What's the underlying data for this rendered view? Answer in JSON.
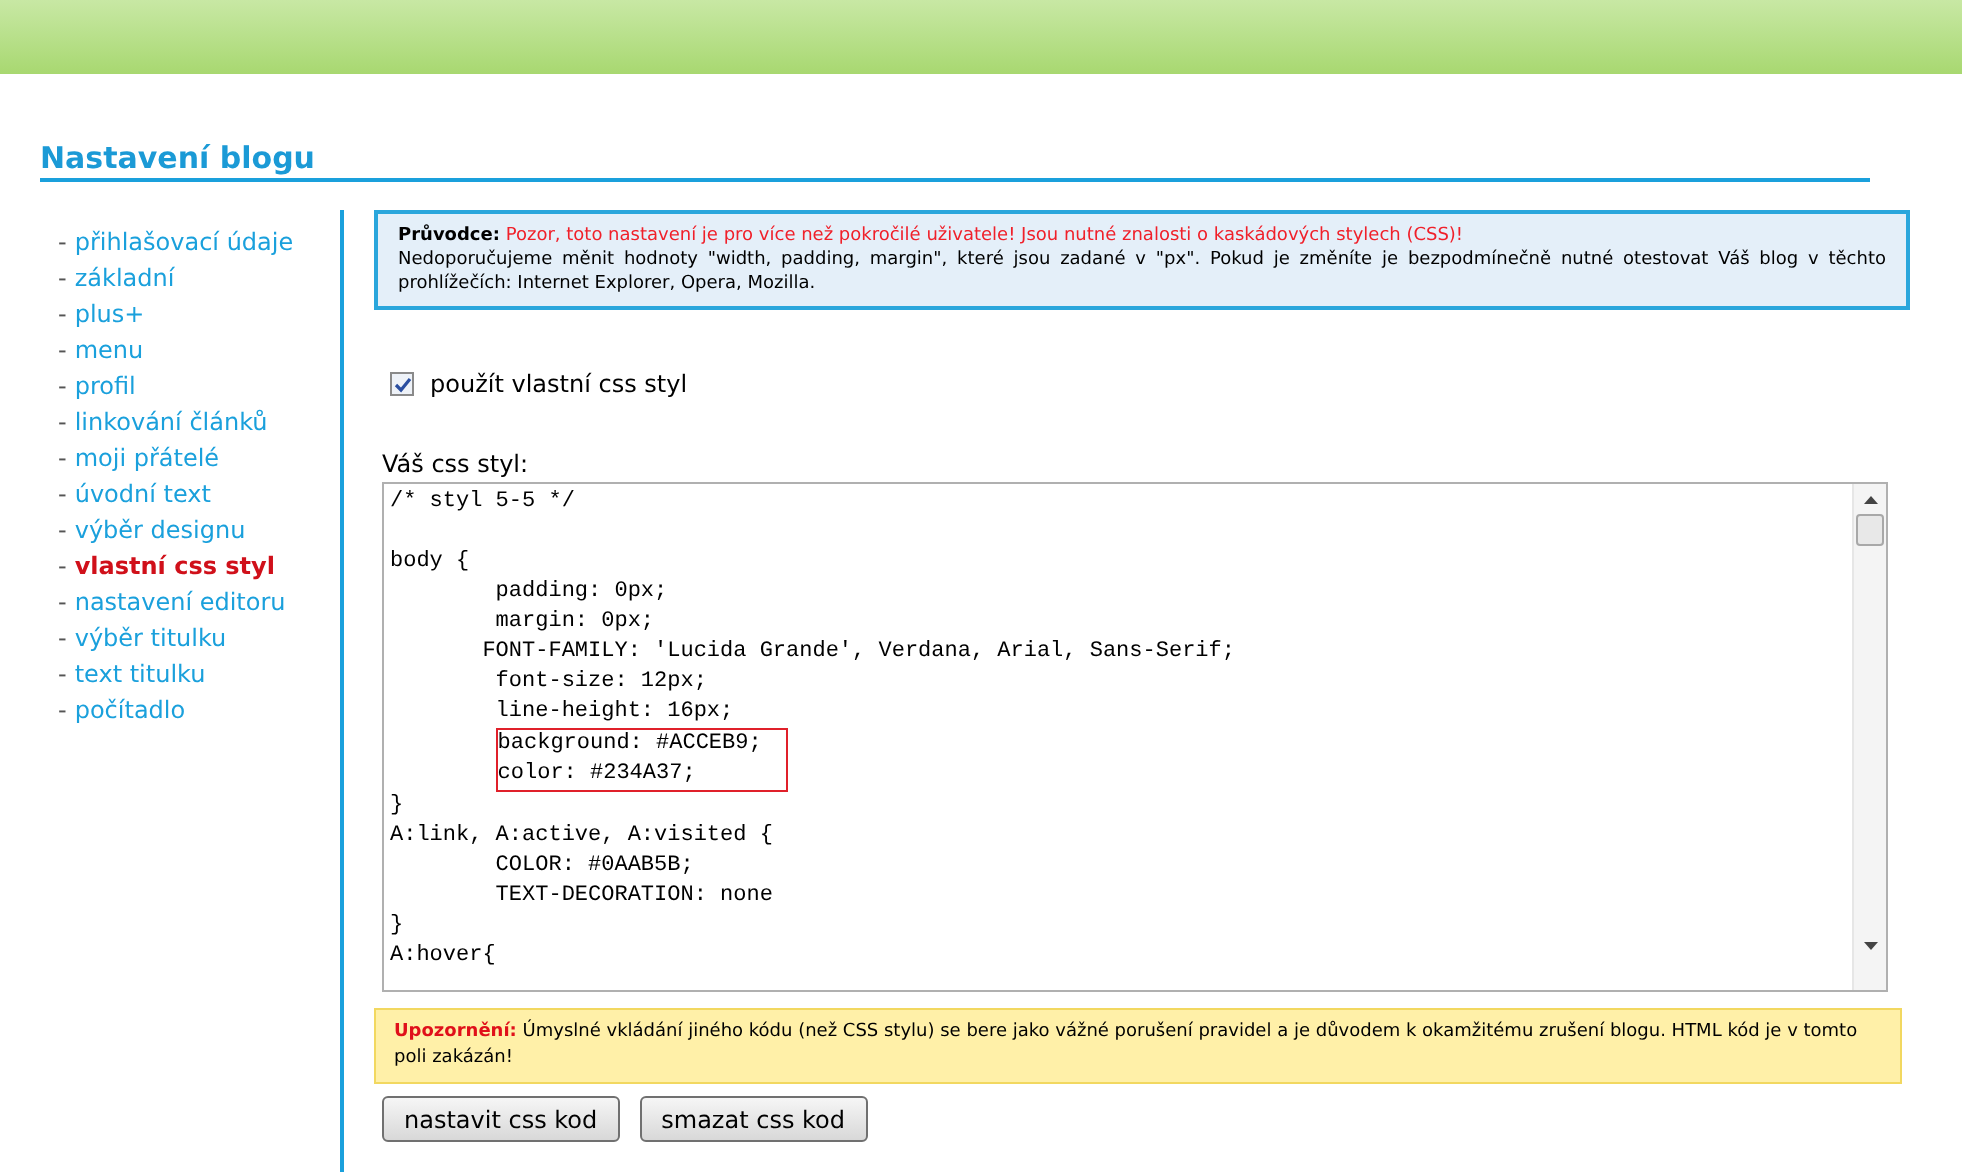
{
  "page": {
    "title": "Nastavení blogu"
  },
  "sidebar": {
    "items": [
      {
        "marker": "-",
        "label": "přihlašovací údaje",
        "selected": false
      },
      {
        "marker": "-",
        "label": "základní",
        "selected": false
      },
      {
        "marker": "-",
        "label": "plus+",
        "selected": false
      },
      {
        "marker": "-",
        "label": "menu",
        "selected": false
      },
      {
        "marker": "-",
        "label": "profil",
        "selected": false
      },
      {
        "marker": "-",
        "label": "linkování článků",
        "selected": false
      },
      {
        "marker": "-",
        "label": "moji přátelé",
        "selected": false
      },
      {
        "marker": "-",
        "label": "úvodní text",
        "selected": false
      },
      {
        "marker": "-",
        "label": "výběr designu",
        "selected": false
      },
      {
        "marker": "-",
        "label": "vlastní css styl",
        "selected": true
      },
      {
        "marker": "-",
        "label": "nastavení editoru",
        "selected": false
      },
      {
        "marker": "-",
        "label": "výběr titulku",
        "selected": false
      },
      {
        "marker": "-",
        "label": "text titulku",
        "selected": false
      },
      {
        "marker": "-",
        "label": "počítadlo",
        "selected": false
      }
    ]
  },
  "notice": {
    "label": "Průvodce:",
    "alert": "Pozor, toto nastavení je pro více než pokročilé uživatele! Jsou nutné znalosti o kaskádových stylech (CSS)!",
    "text": "Nedoporučujeme měnit hodnoty \"width, padding, margin\", které jsou zadané v \"px\". Pokud je změníte je bezpodmínečně nutné otestovat Váš blog v těchto prohlížečích: Internet Explorer, Opera, Mozilla."
  },
  "checkbox": {
    "label": "použít vlastní css styl",
    "checked": true
  },
  "editor": {
    "label": "Váš css styl:",
    "lines": [
      {
        "text": "/* styl 5-5 */",
        "highlighted": false
      },
      {
        "kind": "blank",
        "highlighted": false
      },
      {
        "text": "body {",
        "highlighted": false
      },
      {
        "text": "        padding: 0px;",
        "highlighted": false
      },
      {
        "text": "        margin: 0px;",
        "highlighted": false
      },
      {
        "text": "       FONT-FAMILY: 'Lucida Grande', Verdana, Arial, Sans-Serif;",
        "highlighted": false
      },
      {
        "text": "        font-size: 12px;",
        "highlighted": false
      },
      {
        "text": "        line-height: 16px;",
        "highlighted": false
      },
      {
        "text": "background: #ACCEB9;",
        "highlighted": true
      },
      {
        "text": "color: #234A37;",
        "highlighted": true
      },
      {
        "text": "}",
        "highlighted": false
      },
      {
        "text": "A:link, A:active, A:visited {",
        "highlighted": false
      },
      {
        "text": "        COLOR: #0AAB5B;",
        "highlighted": false
      },
      {
        "text": "        TEXT-DECORATION: none",
        "highlighted": false
      },
      {
        "text": "}",
        "highlighted": false
      },
      {
        "text": "A:hover{",
        "highlighted": false
      }
    ]
  },
  "warning": {
    "label": "Upozornění:",
    "text": "Úmyslné vkládání jiného kódu (než CSS stylu) se bere jako vážné porušení pravidel a je důvodem k okamžitému zrušení blogu. HTML kód je v tomto poli zakázán!"
  },
  "buttons": [
    "nastavit css kod",
    "smazat css kod"
  ]
}
